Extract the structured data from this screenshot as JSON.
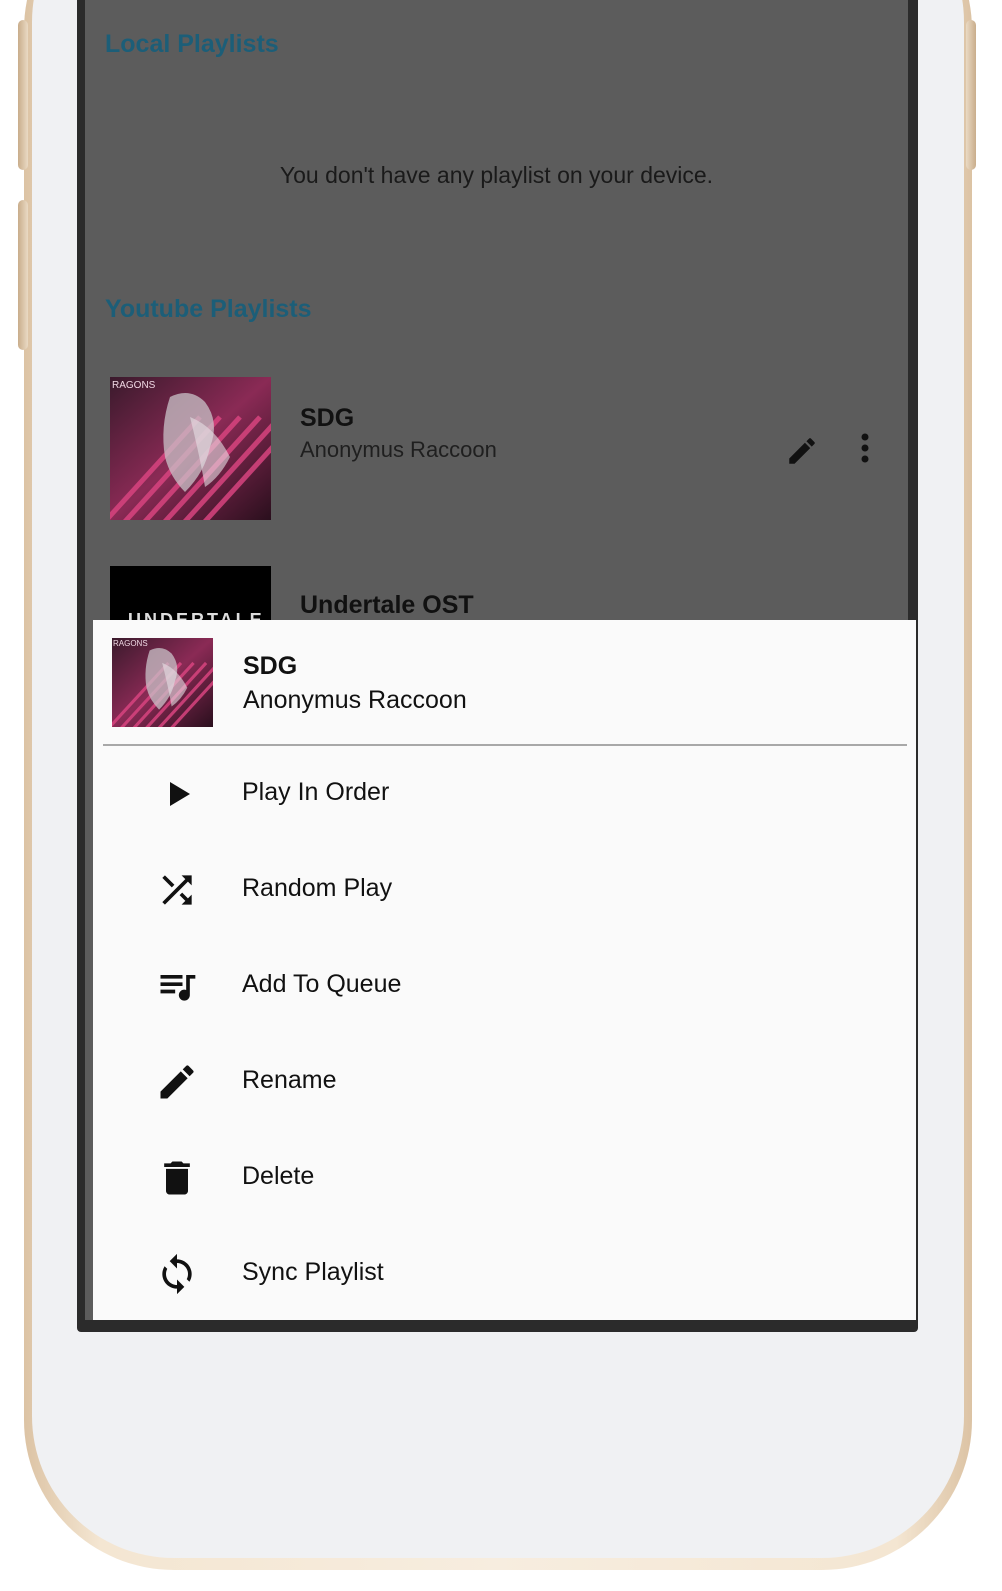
{
  "local_section": {
    "title": "Local Playlists",
    "empty_message": "You don't have any playlist on your device."
  },
  "youtube_section": {
    "title": "Youtube Playlists",
    "playlists": [
      {
        "title": "SDG",
        "subtitle": "Anonymus Raccoon",
        "thumb_text": "RAGONS",
        "edit_icon": "pencil-icon",
        "more_icon": "more-vert-icon"
      },
      {
        "title": "Undertale OST",
        "thumb_text": "UNDERTALE"
      }
    ]
  },
  "sheet": {
    "title": "SDG",
    "subtitle": "Anonymus Raccoon",
    "thumb_text": "RAGONS",
    "items": [
      {
        "label": "Play In Order",
        "icon": "play-icon"
      },
      {
        "label": "Random Play",
        "icon": "shuffle-icon"
      },
      {
        "label": "Add To Queue",
        "icon": "queue-music-icon"
      },
      {
        "label": "Rename",
        "icon": "pencil-icon"
      },
      {
        "label": "Delete",
        "icon": "trash-icon"
      },
      {
        "label": "Sync Playlist",
        "icon": "sync-icon"
      }
    ]
  },
  "colors": {
    "section_title": "#1c5e78",
    "scrim": "#5c5c5c",
    "sheet_bg": "#fafafa",
    "frame_gold": "#f4e6d2"
  }
}
